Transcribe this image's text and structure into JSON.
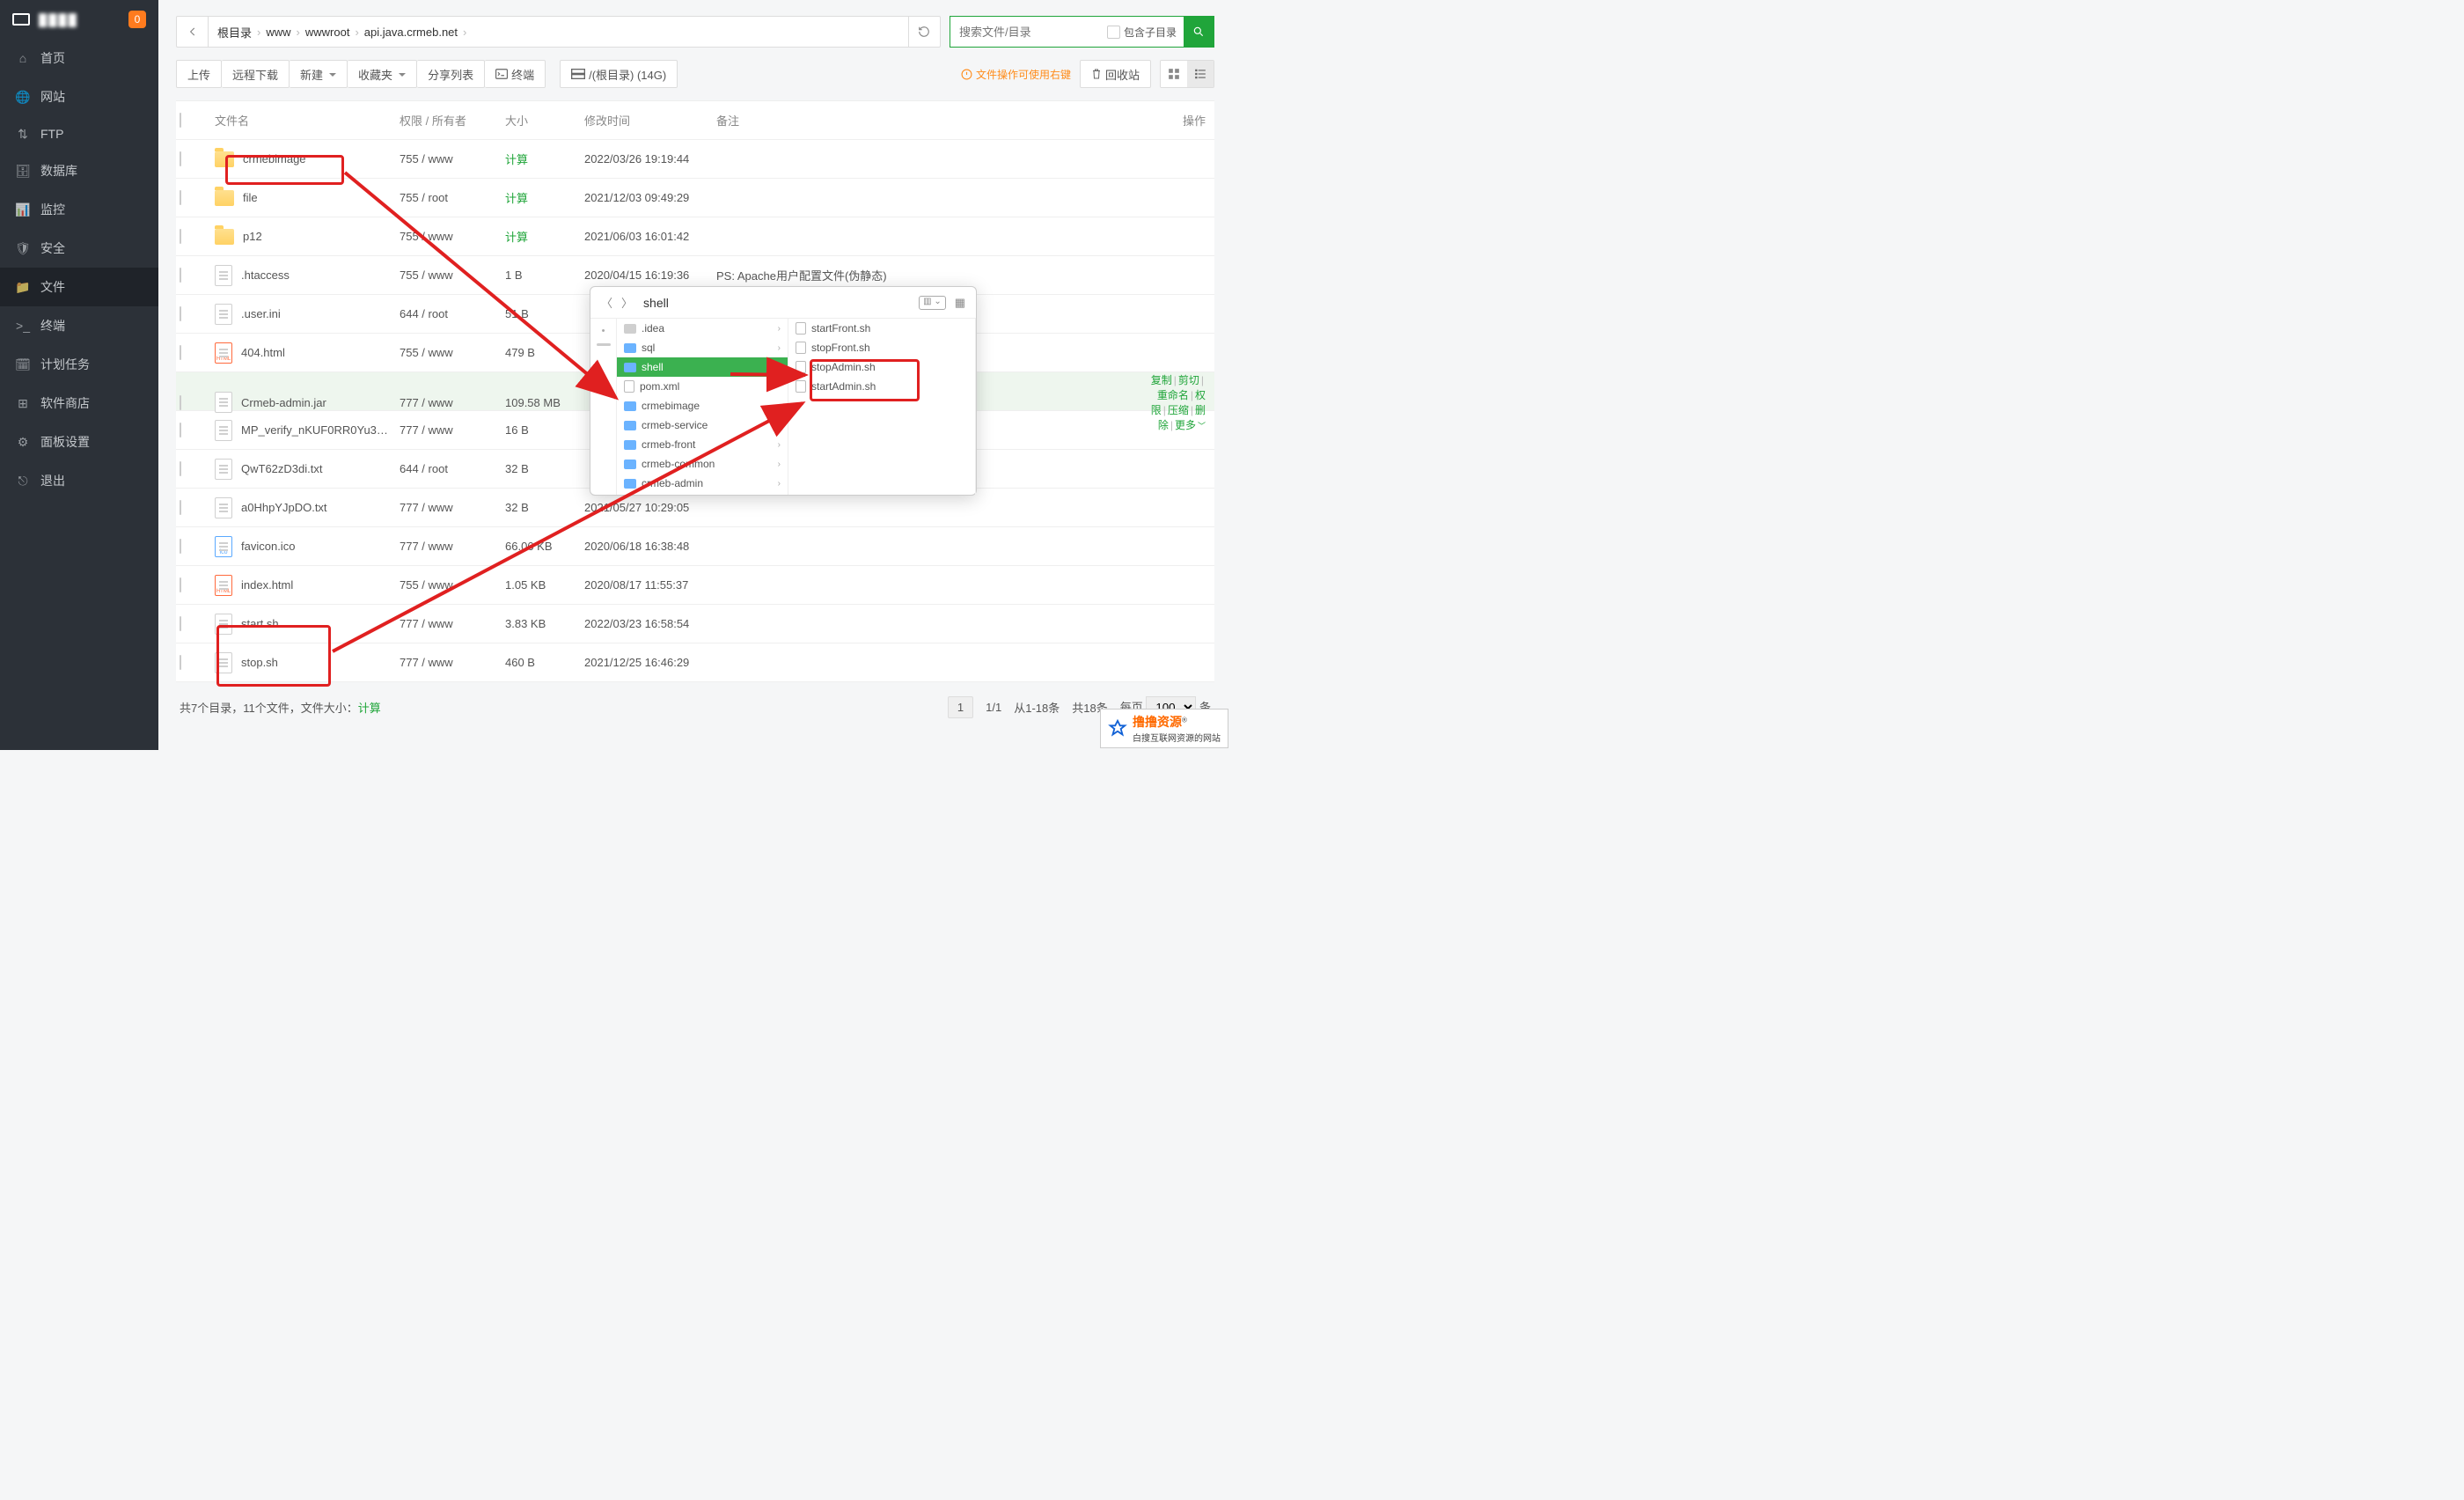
{
  "sidebar": {
    "logo_text": "████",
    "badge": "0",
    "items": [
      {
        "label": "首页"
      },
      {
        "label": "网站"
      },
      {
        "label": "FTP"
      },
      {
        "label": "数据库"
      },
      {
        "label": "监控"
      },
      {
        "label": "安全"
      },
      {
        "label": "文件",
        "active": true
      },
      {
        "label": "终端"
      },
      {
        "label": "计划任务"
      },
      {
        "label": "软件商店"
      },
      {
        "label": "面板设置"
      },
      {
        "label": "退出"
      }
    ]
  },
  "breadcrumb": [
    "根目录",
    "www",
    "wwwroot",
    "api.java.crmeb.net"
  ],
  "search": {
    "placeholder": "搜索文件/目录",
    "subdir_label": "包含子目录"
  },
  "toolbar": {
    "upload": "上传",
    "remote": "远程下载",
    "new": "新建",
    "fav": "收藏夹",
    "share": "分享列表",
    "term": "终端",
    "disk": "/(根目录) (14G)",
    "warn": "文件操作可使用右键",
    "recycle": "回收站"
  },
  "columns": {
    "name": "文件名",
    "perm": "权限 / 所有者",
    "size": "大小",
    "mtime": "修改时间",
    "note": "备注",
    "ops": "操作"
  },
  "rows": [
    {
      "type": "folder",
      "name": "crmebimage",
      "perm": "755 / www",
      "size": "计算",
      "mtime": "2022/03/26 19:19:44",
      "note": ""
    },
    {
      "type": "folder",
      "name": "file",
      "perm": "755 / root",
      "size": "计算",
      "mtime": "2021/12/03 09:49:29",
      "note": ""
    },
    {
      "type": "folder",
      "name": "p12",
      "perm": "755 / www",
      "size": "计算",
      "mtime": "2021/06/03 16:01:42",
      "note": ""
    },
    {
      "type": "file",
      "name": ".htaccess",
      "perm": "755 / www",
      "size": "1 B",
      "mtime": "2020/04/15 16:19:36",
      "note": "PS: Apache用户配置文件(伪静态)"
    },
    {
      "type": "file",
      "name": ".user.ini",
      "perm": "644 / root",
      "size": "51 B",
      "mtime": "",
      "note": ""
    },
    {
      "type": "html",
      "name": "404.html",
      "perm": "755 / www",
      "size": "479 B",
      "mtime": "",
      "note": ""
    },
    {
      "type": "file",
      "name": "Crmeb-admin.jar",
      "perm": "777 / www",
      "size": "109.58 MB",
      "mtime": "",
      "note": "",
      "hover": true,
      "ops": [
        "复制",
        "剪切",
        "重命名",
        "权限",
        "压缩",
        "删除",
        "更多"
      ]
    },
    {
      "type": "file",
      "name": "MP_verify_nKUF0RR0Yu3…",
      "perm": "777 / www",
      "size": "16 B",
      "mtime": "",
      "note": ""
    },
    {
      "type": "file",
      "name": "QwT62zD3di.txt",
      "perm": "644 / root",
      "size": "32 B",
      "mtime": "",
      "note": ""
    },
    {
      "type": "file",
      "name": "a0HhpYJpDO.txt",
      "perm": "777 / www",
      "size": "32 B",
      "mtime": "2021/05/27 10:29:05",
      "note": ""
    },
    {
      "type": "ico",
      "name": "favicon.ico",
      "perm": "777 / www",
      "size": "66.06 KB",
      "mtime": "2020/06/18 16:38:48",
      "note": ""
    },
    {
      "type": "html",
      "name": "index.html",
      "perm": "755 / www",
      "size": "1.05 KB",
      "mtime": "2020/08/17 11:55:37",
      "note": ""
    },
    {
      "type": "file",
      "name": "start.sh",
      "perm": "777 / www",
      "size": "3.83 KB",
      "mtime": "2022/03/23 16:58:54",
      "note": ""
    },
    {
      "type": "file",
      "name": "stop.sh",
      "perm": "777 / www",
      "size": "460 B",
      "mtime": "2021/12/25 16:46:29",
      "note": ""
    }
  ],
  "footer": {
    "summary_a": "共7个目录，11个文件，文件大小：",
    "summary_b": "计算",
    "page": "1",
    "pages": "1/1",
    "range": "从1-18条",
    "total": "共18条",
    "perpage_label": "每页",
    "perpage_val": "100",
    "perpage_unit": "条"
  },
  "popup": {
    "title": "shell",
    "mid": [
      {
        "label": ".idea",
        "grey": true,
        "chev": true
      },
      {
        "label": "sql",
        "chev": true
      },
      {
        "label": "shell",
        "sel": true,
        "chev": true
      },
      {
        "label": "pom.xml",
        "file": true
      },
      {
        "label": "crmebimage",
        "chev": true
      },
      {
        "label": "crmeb-service",
        "chev": true
      },
      {
        "label": "crmeb-front",
        "chev": true
      },
      {
        "label": "crmeb-common",
        "chev": true
      },
      {
        "label": "crmeb-admin",
        "chev": true
      }
    ],
    "right": [
      {
        "label": "startFront.sh"
      },
      {
        "label": "stopFront.sh"
      },
      {
        "label": "stopAdmin.sh"
      },
      {
        "label": "startAdmin.sh"
      }
    ]
  },
  "watermark": {
    "brand": "撸撸资源",
    "sub": "白搜互联网资源的网站"
  }
}
